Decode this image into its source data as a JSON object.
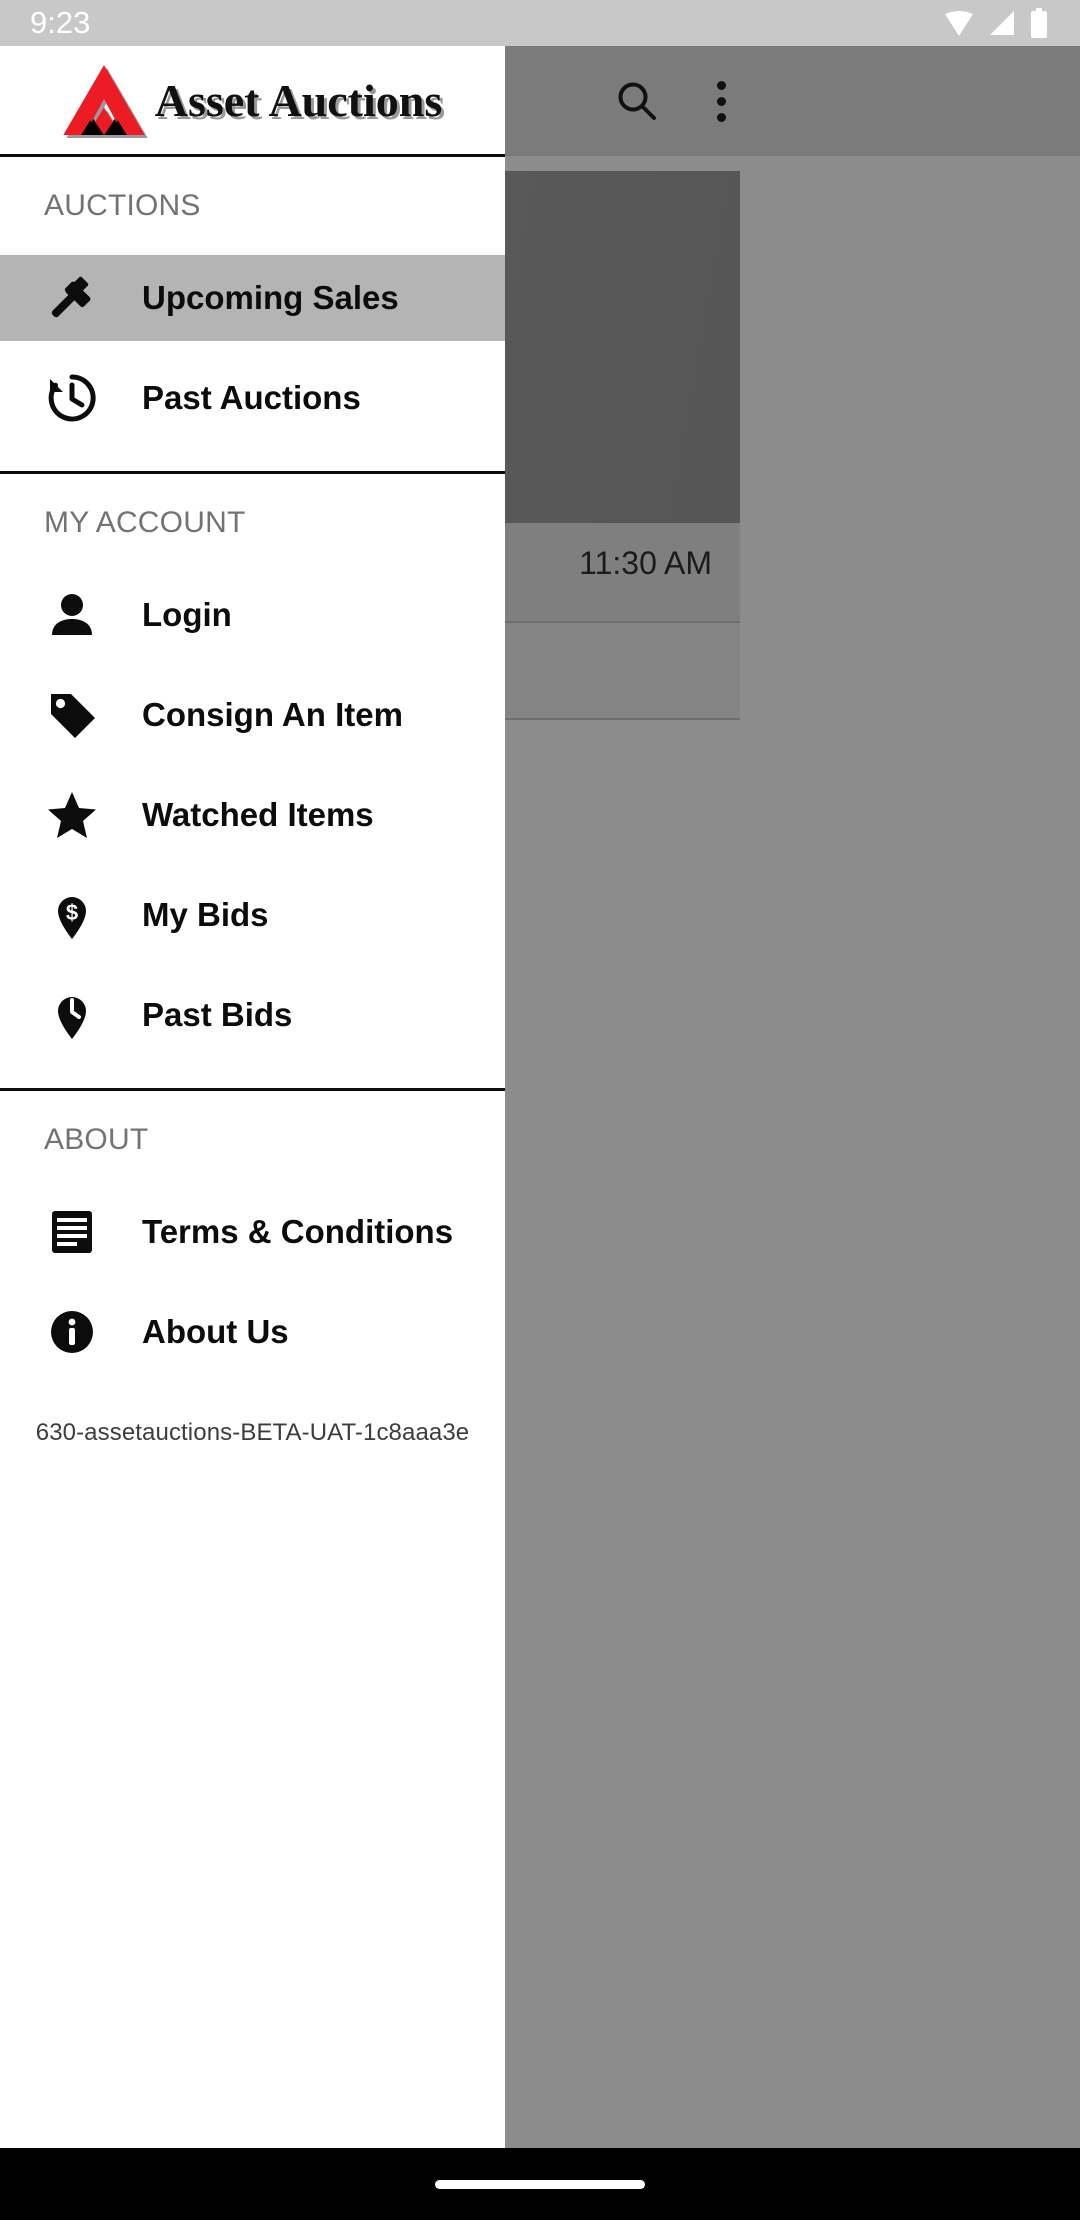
{
  "status_bar": {
    "time": "9:23",
    "icons": [
      "wifi-icon",
      "cellular-signal-icon",
      "battery-icon"
    ]
  },
  "background_app": {
    "toolbar": {
      "search_icon": "search-icon",
      "overflow_icon": "more-vertical-icon"
    },
    "card": {
      "time_label": "11:30 AM"
    }
  },
  "drawer": {
    "brand": {
      "name": "Asset Auctions",
      "logo_icon": "asset-auctions-logo-icon",
      "logo_red": "#ED1C24",
      "logo_black": "#000000"
    },
    "sections": [
      {
        "id": "auctions",
        "header": "AUCTIONS",
        "items": [
          {
            "label": "Upcoming Sales",
            "icon": "gavel-icon",
            "selected": true
          },
          {
            "label": "Past Auctions",
            "icon": "history-icon",
            "selected": false
          }
        ]
      },
      {
        "id": "my-account",
        "header": "MY ACCOUNT",
        "items": [
          {
            "label": "Login",
            "icon": "person-icon",
            "selected": false
          },
          {
            "label": "Consign An Item",
            "icon": "tag-icon",
            "selected": false
          },
          {
            "label": "Watched Items",
            "icon": "star-icon",
            "selected": false
          },
          {
            "label": "My Bids",
            "icon": "dollar-pin-icon",
            "selected": false
          },
          {
            "label": "Past Bids",
            "icon": "clock-pin-icon",
            "selected": false
          }
        ]
      },
      {
        "id": "about",
        "header": "ABOUT",
        "items": [
          {
            "label": "Terms & Conditions",
            "icon": "document-icon",
            "selected": false
          },
          {
            "label": "About Us",
            "icon": "info-icon",
            "selected": false
          }
        ]
      }
    ],
    "build_string": "630-assetauctions-BETA-UAT-1c8aaa3e"
  },
  "nav_bar": {
    "handle": "gesture-handle"
  }
}
